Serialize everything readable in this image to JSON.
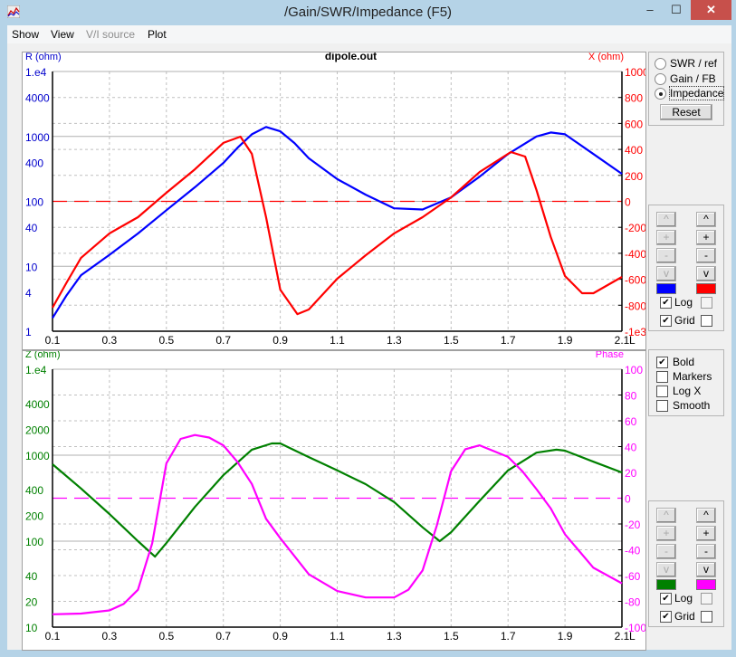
{
  "window": {
    "title": "/Gain/SWR/Impedance (F5)",
    "minimize": "‒",
    "maximize": "☐",
    "close": "✕"
  },
  "menu": [
    {
      "label": "Show",
      "enabled": true
    },
    {
      "label": "View",
      "enabled": true
    },
    {
      "label": "V/I source",
      "enabled": false
    },
    {
      "label": "Plot",
      "enabled": true
    }
  ],
  "mode_group": {
    "options": [
      "SWR / ref",
      "Gain / FB",
      "Impedance"
    ],
    "selected": "Impedance",
    "reset_label": "Reset"
  },
  "top_controls": {
    "left_buttons": [
      "^",
      "+",
      "-",
      "v"
    ],
    "right_buttons": [
      "^",
      "+",
      "-",
      "v"
    ],
    "left_enabled": false,
    "right_enabled": true,
    "left_color": "#0000ff",
    "right_color": "#ff0000",
    "log_label": "Log",
    "grid_label": "Grid",
    "left_log": true,
    "right_log": false,
    "left_grid": true,
    "right_grid": false
  },
  "options_group": {
    "items": [
      {
        "label": "Bold",
        "checked": true
      },
      {
        "label": "Markers",
        "checked": false
      },
      {
        "label": "Log X",
        "checked": false
      },
      {
        "label": "Smooth",
        "checked": false
      }
    ]
  },
  "bottom_controls": {
    "left_buttons": [
      "^",
      "+",
      "-",
      "v"
    ],
    "right_buttons": [
      "^",
      "+",
      "-",
      "v"
    ],
    "left_enabled": false,
    "right_enabled": true,
    "left_color": "#008000",
    "right_color": "#ff00ff",
    "log_label": "Log",
    "grid_label": "Grid",
    "left_log": true,
    "right_log": false,
    "left_grid": true,
    "right_grid": false
  },
  "chart_data": [
    {
      "type": "line",
      "title": "dipole.out",
      "xlabel": "L",
      "x_ticks": [
        "0.1",
        "0.3",
        "0.5",
        "0.7",
        "0.9",
        "1.1",
        "1.3",
        "1.5",
        "1.7",
        "1.9",
        "2.1"
      ],
      "xlim": [
        0.1,
        2.1
      ],
      "left_axis": {
        "label": "R (ohm)",
        "scale": "log",
        "ylim": [
          1,
          10000
        ],
        "ticks": [
          "1.e4",
          "4000",
          "1000",
          "400",
          "100",
          "40",
          "10",
          "4",
          "1"
        ],
        "color": "#0000cc"
      },
      "right_axis": {
        "label": "X (ohm)",
        "scale": "linear",
        "ylim": [
          -1000,
          1000
        ],
        "ticks": [
          "1000",
          "800",
          "600",
          "400",
          "200",
          "0",
          "-200",
          "-400",
          "-600",
          "-800",
          "-1e3"
        ],
        "color": "#ff0000"
      },
      "grid": true,
      "zero_line": {
        "axis": "right",
        "value": 0,
        "style": "dashed",
        "color": "#ff0000"
      },
      "series": [
        {
          "name": "R",
          "axis": "left",
          "color": "#0000ff",
          "x": [
            0.1,
            0.15,
            0.2,
            0.3,
            0.4,
            0.5,
            0.6,
            0.7,
            0.75,
            0.8,
            0.85,
            0.9,
            0.95,
            1.0,
            1.1,
            1.2,
            1.3,
            1.4,
            1.5,
            1.6,
            1.7,
            1.8,
            1.85,
            1.9,
            2.0,
            2.1
          ],
          "y": [
            1.6,
            3.6,
            7.3,
            15,
            32,
            73,
            165,
            390,
            670,
            1080,
            1400,
            1200,
            790,
            460,
            220,
            127,
            78,
            75,
            115,
            240,
            535,
            1000,
            1150,
            1080,
            535,
            265
          ]
        },
        {
          "name": "X",
          "axis": "right",
          "color": "#ff0000",
          "x": [
            0.1,
            0.15,
            0.2,
            0.3,
            0.4,
            0.5,
            0.6,
            0.7,
            0.76,
            0.8,
            0.85,
            0.9,
            0.96,
            1.0,
            1.1,
            1.2,
            1.3,
            1.4,
            1.5,
            1.6,
            1.71,
            1.76,
            1.8,
            1.85,
            1.9,
            1.96,
            2.0,
            2.1
          ],
          "y": [
            -819,
            -624,
            -435,
            -247,
            -122,
            66,
            247,
            450,
            498,
            366,
            -122,
            -680,
            -868,
            -833,
            -596,
            -415,
            -247,
            -122,
            31,
            226,
            380,
            345,
            87,
            -275,
            -575,
            -707,
            -707,
            -582
          ]
        }
      ]
    },
    {
      "type": "line",
      "title": "",
      "xlabel": "L",
      "x_ticks": [
        "0.1",
        "0.3",
        "0.5",
        "0.7",
        "0.9",
        "1.1",
        "1.3",
        "1.5",
        "1.7",
        "1.9",
        "2.1"
      ],
      "xlim": [
        0.1,
        2.1
      ],
      "left_axis": {
        "label": "Z (ohm)",
        "scale": "log",
        "ylim": [
          10,
          10000
        ],
        "ticks": [
          "1.e4",
          "4000",
          "2000",
          "1000",
          "400",
          "200",
          "100",
          "40",
          "20",
          "10"
        ],
        "color": "#008000"
      },
      "right_axis": {
        "label": "Phase",
        "scale": "linear",
        "ylim": [
          -100,
          100
        ],
        "ticks": [
          "100",
          "80",
          "60",
          "40",
          "20",
          "0",
          "-20",
          "-40",
          "-60",
          "-80",
          "-100"
        ],
        "color": "#ff00ff"
      },
      "grid": true,
      "zero_line": {
        "axis": "right",
        "value": 0,
        "style": "dashed",
        "color": "#ff00ff"
      },
      "series": [
        {
          "name": "Z",
          "axis": "left",
          "color": "#008000",
          "x": [
            0.1,
            0.2,
            0.3,
            0.4,
            0.46,
            0.5,
            0.6,
            0.7,
            0.8,
            0.87,
            0.9,
            1.0,
            1.1,
            1.2,
            1.3,
            1.4,
            1.46,
            1.5,
            1.6,
            1.7,
            1.8,
            1.87,
            1.9,
            2.0,
            2.1
          ],
          "y": [
            785,
            410,
            207,
            100,
            66,
            95,
            250,
            585,
            1160,
            1370,
            1370,
            950,
            665,
            460,
            285,
            145,
            100,
            127,
            295,
            665,
            1070,
            1160,
            1130,
            840,
            630
          ]
        },
        {
          "name": "Phase",
          "axis": "right",
          "color": "#ff00ff",
          "x": [
            0.1,
            0.2,
            0.3,
            0.35,
            0.4,
            0.45,
            0.5,
            0.55,
            0.6,
            0.65,
            0.7,
            0.75,
            0.8,
            0.85,
            0.9,
            1.0,
            1.1,
            1.2,
            1.3,
            1.35,
            1.4,
            1.45,
            1.5,
            1.55,
            1.6,
            1.7,
            1.75,
            1.8,
            1.85,
            1.9,
            2.0,
            2.1
          ],
          "y": [
            -90,
            -89.5,
            -87,
            -82,
            -71,
            -35,
            27,
            46,
            49,
            47,
            41,
            28,
            11,
            -16,
            -31,
            -59,
            -72,
            -77,
            -77,
            -71,
            -56,
            -21,
            21,
            38,
            41,
            32,
            21,
            7,
            -8,
            -28,
            -54,
            -66
          ]
        }
      ]
    }
  ]
}
